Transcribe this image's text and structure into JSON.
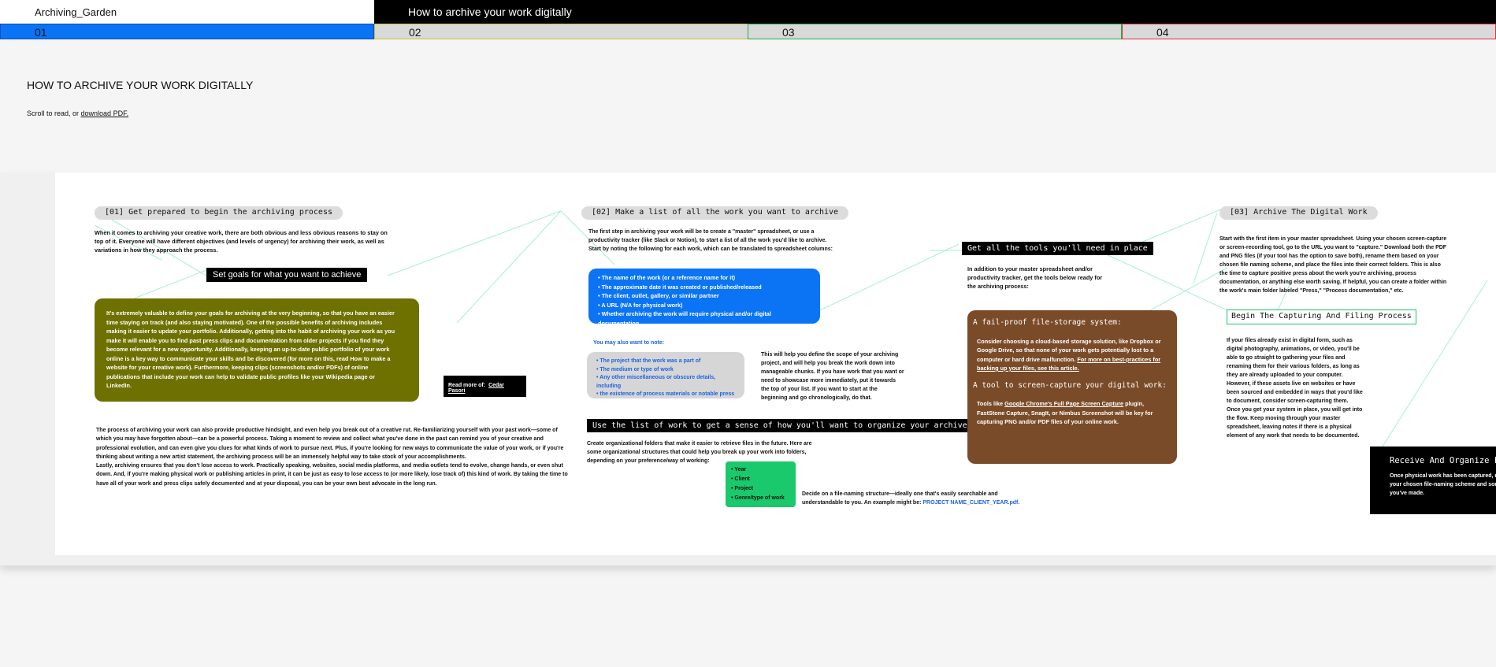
{
  "site": {
    "title": "Archiving_Garden"
  },
  "header": {
    "page_heading": "How to archive your work digitally"
  },
  "tabs": [
    {
      "label": "01"
    },
    {
      "label": "02"
    },
    {
      "label": "03"
    },
    {
      "label": "04"
    }
  ],
  "intro": {
    "title": "HOW TO ARCHIVE YOUR WORK DIGITALLY",
    "scroll_text": "Scroll to read, or ",
    "download_link": "download PDF."
  },
  "colors": {
    "tab1": "#0a74f5",
    "olive": "#6e7100",
    "blue": "#0a74f5",
    "brown": "#7a4b28",
    "green": "#19c96c"
  },
  "section1": {
    "pill": "[01] Get prepared to begin the archiving process",
    "intro_lines": [
      "When it comes to archiving your creative work, there are both obvious and less obvious reasons to stay on",
      "top of it. Everyone will have different objectives (and levels of urgency) for archiving their work, as well as",
      "variations in how they approach the process."
    ],
    "goals_heading": "Set goals for what you want to achieve",
    "olive_lines": [
      "It's extremely valuable to define your goals for archiving at the very beginning, so that you have an easier",
      "time staying on track (and also staying motivated). One of the possible benefits of archiving includes",
      "making it easier to update your portfolio. Additionally, getting into the habit of archiving your work as you",
      "make it will enable you to find past press clips and documentation from older projects if you find they",
      "become relevant for a new opportunity. Additionally, keeping an up-to-date public portfolio of your work",
      "online is a key way to communicate your skills and be discovered (for more on this, read How to make a",
      "website for your creative work). Furthermore, keeping clips (screenshots and/or PDFs) of online",
      "publications that include your work can help to validate public profiles like your Wikipedia page or",
      "LinkedIn."
    ],
    "read_more_label": "Read more of:",
    "read_more_link": "Cedar Pasori",
    "bottom_lines": [
      "The process of archiving your work can also provide productive hindsight, and even help you break out of a creative rut. Re-familiarizing yourself with your past work—some of",
      "which you may have forgotten about—can be a powerful process. Taking a moment to review and collect what you've done in the past can remind you of your creative and",
      "professional evolution, and can even give you clues for what kinds of work to pursue next. Plus, if you're looking for new ways to communicate the value of your work, or if you're",
      "thinking about writing a new artist statement, the archiving process will be an immensely helpful way to take stock of your accomplishments.",
      "Lastly, archiving ensures that you don't lose access to work. Practically speaking, websites, social media platforms, and media outlets tend to evolve, change hands, or even shut",
      "down. And, if you're making physical work or publishing articles in print, it can be just as easy to lose access to (or more likely, lose track of) this kind of work. By taking the time to",
      "have all of your work and press clips safely documented and at your disposal, you can be your own best advocate in the long run."
    ]
  },
  "section2": {
    "pill": "[02] Make a list of all the work you want to archive",
    "intro_lines": [
      "The first step in archiving your work will be to create a \"master\" spreadsheet, or use a",
      "productivity tracker (like Slack or Notion), to start a list of all the work you'd like to archive.",
      "Start by noting the following for each work, which can be translated to spreadsheet columns:"
    ],
    "blue_items": [
      "The name of the work (or a reference name for it)",
      "The approximate date it was created or published/released",
      "The client, outlet, gallery, or similar partner",
      "A URL (N/A for physical work)",
      "Whether archiving the work will require physical and/or digital documentation"
    ],
    "also_note": "You may also want to note:",
    "grey_items": [
      "The project that the work was a part of",
      "The medium or type of work",
      "Any other miscellaneous or obscure details, including",
      "the existence of process materials or notable press"
    ],
    "scope_lines": [
      "This will help you define the scope of your archiving",
      "project, and will help you break the work down into",
      "manageable chunks. If you have work that you want or",
      "need to showcase more immediately, put it towards",
      "the top of your list. If you want to start at the",
      "beginning and go chronologically, do that."
    ],
    "organize_heading": "Use the list of work to get a sense of how you'll want to organize your archive",
    "organize_lines": [
      "Create organizational folders that make it easier to retrieve files in the future. Here are",
      "some organizational structures that could help you break up your work into folders,",
      "depending on your preference/way of working:"
    ],
    "green_items": [
      "Year",
      "Client",
      "Project",
      "Genre/type of work"
    ],
    "naming_line1": "Decide on a file-naming structure—ideally one that's easily searchable and",
    "naming_line2": "understandable to you. An example might be: ",
    "naming_example": "PROJECT NAME_CLIENT_YEAR.pdf."
  },
  "tools": {
    "heading": "Get all the tools you'll need in place",
    "intro_lines": [
      "In addition to your master spreadsheet and/or",
      "productivity tracker, get the tools below ready for",
      "the archiving process:"
    ],
    "storage_heading": "A fail-proof file-storage system:",
    "storage_lines": [
      "Consider choosing a cloud-based storage solution, like Dropbox or",
      "Google Drive, so that none of your work gets potentially lost to a",
      "computer or hard drive malfunction. "
    ],
    "storage_link": "For more on best-practices for backing up your files, see this article.",
    "capture_heading": "A tool to screen-capture your digital work:",
    "capture_prefix": "Tools like ",
    "capture_link": "Google Chrome's Full Page Screen Capture",
    "capture_rest": " plugin, FastStone Capture, SnagIt, or Nimbus Screenshot will be key for capturing PNG and/or PDF files of your online work."
  },
  "section3": {
    "pill": "[03] Archive The Digital Work",
    "intro_lines": [
      "Start with the first item in your master spreadsheet. Using your chosen screen-capture",
      "or screen-recording tool, go to the URL you want to \"capture.\" Download both the PDF",
      "and PNG files (if your tool has the option to save both), rename them based on your",
      "chosen file naming scheme, and place the files into their correct folders. This is also",
      "the time to capture positive press about the work you're archiving, process",
      "documentation, or anything else worth saving. If helpful, you can create a folder within",
      "the work's main folder labeled \"Press,\" \"Process documentation,\" etc."
    ],
    "capture_box": "Begin The Capturing And Filing Process",
    "capture_lines": [
      "If your files already exist in digital form, such as",
      "digital photography, animations, or video, you'll be",
      "able to go straight to gathering your files and",
      "renaming them for their various folders, as long as",
      "they are already uploaded to your computer.",
      "However, if these assets live on websites or have",
      "been sourced and embedded in ways that you'd like",
      "to document, consider screen-capturing them.",
      "Once you get your system in place, you will get into",
      "the flow. Keep moving through your master",
      "spreadsheet, leaving notes if there is a physical",
      "element of any work that needs to be documented."
    ],
    "receive_heading": "Receive And Organize Files",
    "receive_lines": [
      "Once physical work has been captured, rename",
      "your chosen file-naming scheme and sort",
      "you've made."
    ]
  }
}
